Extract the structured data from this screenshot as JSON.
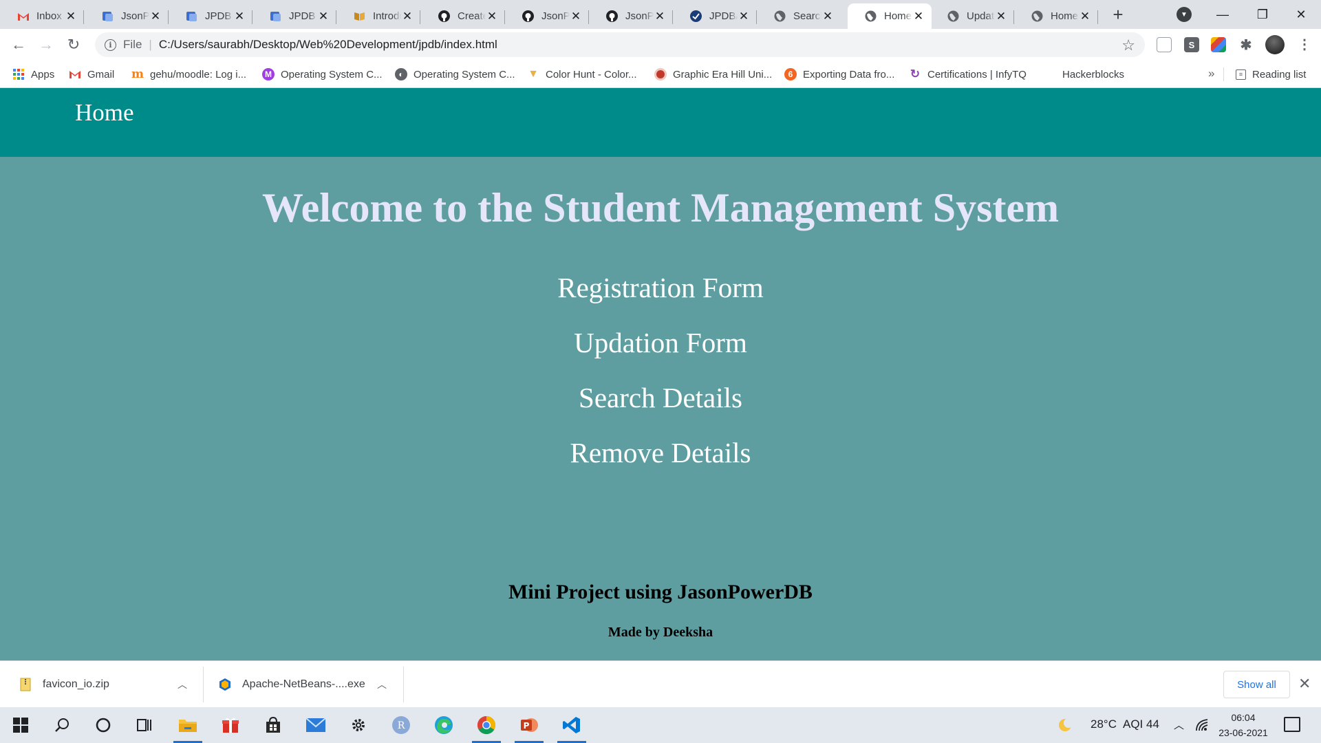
{
  "browser": {
    "tabs": [
      {
        "label": "Inbox",
        "icon": "gmail-icon"
      },
      {
        "label": "JsonPowerDB",
        "icon": "jpdb-icon"
      },
      {
        "label": "JPDB - ",
        "icon": "jpdb-icon"
      },
      {
        "label": "JPDB - ",
        "icon": "jpdb-icon"
      },
      {
        "label": "Introduction",
        "icon": "book-icon"
      },
      {
        "label": "Create",
        "icon": "github-icon"
      },
      {
        "label": "JsonPowerDB",
        "icon": "github-icon"
      },
      {
        "label": "JsonPowerDB",
        "icon": "github-icon"
      },
      {
        "label": "JPDB/",
        "icon": "check-circle-icon"
      },
      {
        "label": "Search",
        "icon": "globe-icon"
      },
      {
        "label": "Home",
        "icon": "globe-icon"
      },
      {
        "label": "Update",
        "icon": "globe-icon"
      },
      {
        "label": "Home",
        "icon": "globe-icon"
      }
    ],
    "active_tab_index": 10,
    "address": {
      "scheme": "File",
      "url": "C:/Users/saurabh/Desktop/Web%20Development/jpdb/index.html"
    },
    "bookmarks": [
      {
        "label": "Apps",
        "icon": "apps-grid-icon"
      },
      {
        "label": "Gmail",
        "icon": "gmail-icon"
      },
      {
        "label": "gehu/moodle: Log i...",
        "icon": "moodle-icon"
      },
      {
        "label": "Operating System C...",
        "icon": "m-circle-icon"
      },
      {
        "label": "Operating System C...",
        "icon": "globe-icon"
      },
      {
        "label": "Color Hunt - Color...",
        "icon": "colorhunt-icon"
      },
      {
        "label": "Graphic Era Hill Uni...",
        "icon": "university-icon"
      },
      {
        "label": "Exporting Data fro...",
        "icon": "orange-circle-icon"
      },
      {
        "label": "Certifications | InfyTQ",
        "icon": "infytq-icon"
      },
      {
        "label": "Hackerblocks",
        "icon": ""
      }
    ],
    "bookmarks_more": "»",
    "reading_list": "Reading list"
  },
  "page": {
    "header_link": "Home",
    "heading": "Welcome to the Student Management System",
    "links": [
      "Registration Form",
      "Updation Form",
      "Search Details",
      "Remove Details"
    ],
    "footer_title": "Mini Project using JasonPowerDB",
    "footer_credit": "Made by Deeksha",
    "colors": {
      "header_bg": "#008b8b",
      "body_bg": "#5f9ea0",
      "heading": "#e6e6fa",
      "link": "#ffffff"
    }
  },
  "downloads": {
    "items": [
      {
        "name": "favicon_io.zip",
        "icon": "zip-file-icon"
      },
      {
        "name": "Apache-NetBeans-....exe",
        "icon": "netbeans-icon"
      }
    ],
    "show_all": "Show all"
  },
  "taskbar": {
    "apps": [
      "windows-start-icon",
      "search-icon",
      "cortana-icon",
      "task-view-icon",
      "file-explorer-icon",
      "gift-icon",
      "store-icon",
      "mail-icon",
      "settings-icon",
      "r-app-icon",
      "edge-icon",
      "chrome-icon",
      "powerpoint-icon",
      "vscode-icon"
    ],
    "weather": "28°C",
    "aqi": "AQI 44",
    "time": "06:04",
    "date": "23-06-2021"
  }
}
